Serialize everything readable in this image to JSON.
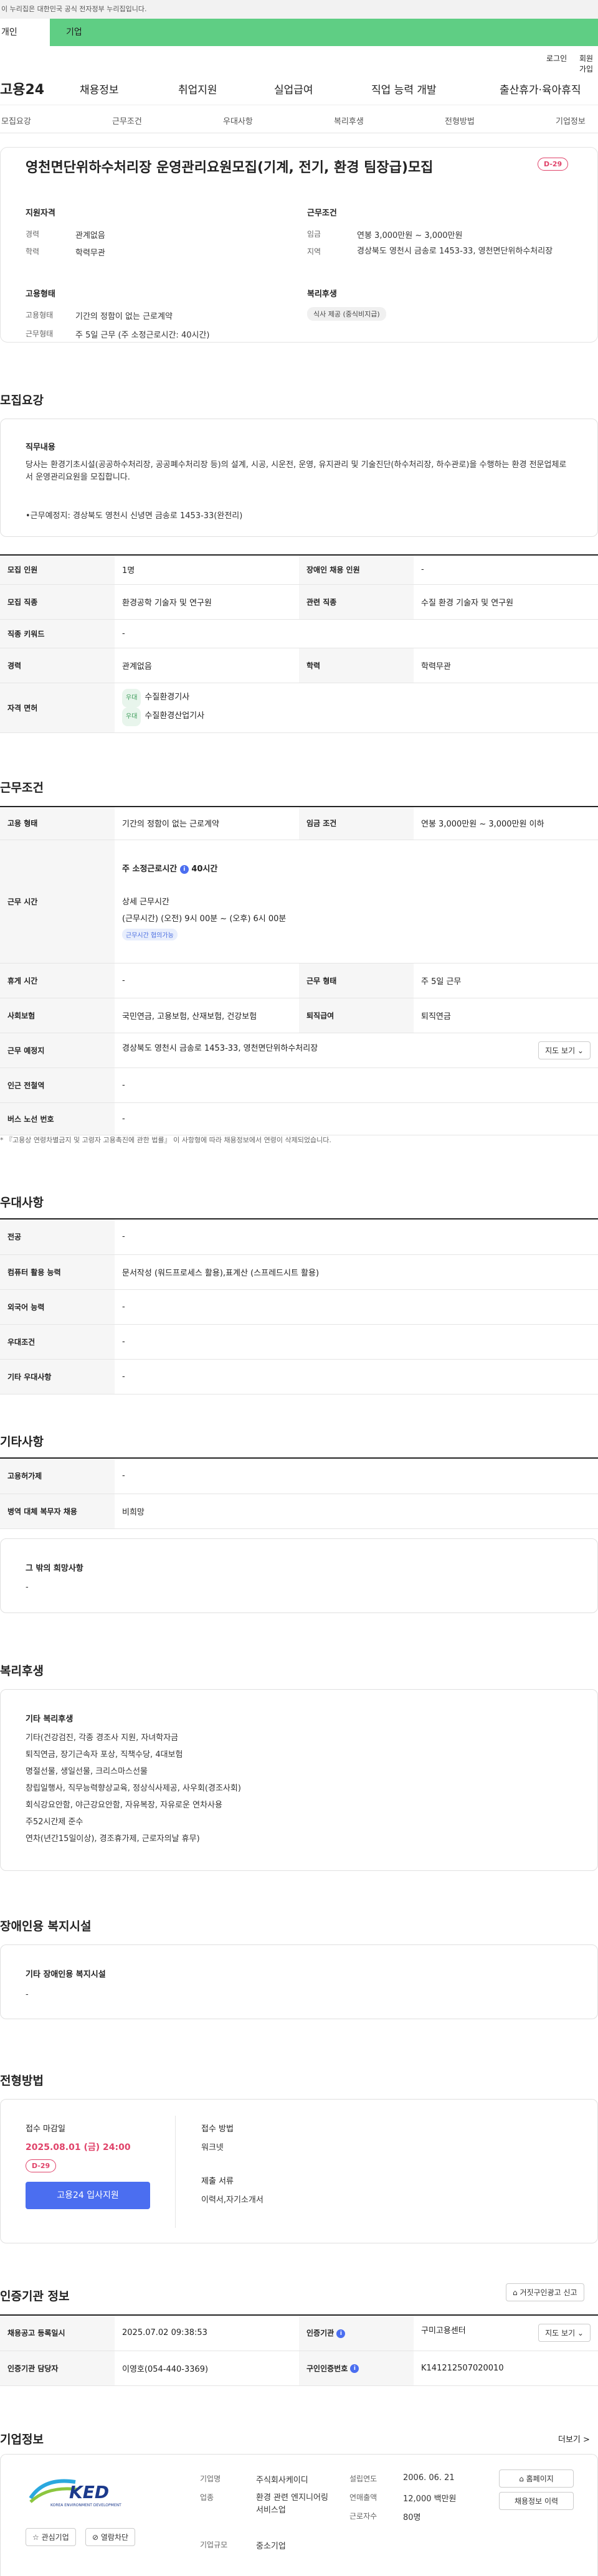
{
  "gov_banner": "이 누리집은 대한민국 공식 전자정부 누리집입니다.",
  "top_tabs": [
    "개인",
    "기업"
  ],
  "util": {
    "login": "로그인",
    "signup": "회원가입"
  },
  "logo": "고용24",
  "gnb": [
    "채용정보",
    "취업지원",
    "실업급여",
    "직업 능력 개발",
    "출산휴가·육아휴직"
  ],
  "snb": [
    "모집요강",
    "근무조건",
    "우대사항",
    "복리후생",
    "전형방법",
    "기업정보"
  ],
  "title_card": {
    "title": "영천면단위하수처리장 운영관리요원모집(기계, 전기, 환경 팀장급)모집",
    "dday": "D-29",
    "qual_title": "지원자격",
    "qual": [
      {
        "k": "경력",
        "v": "관계없음"
      },
      {
        "k": "학력",
        "v": "학력무관"
      }
    ],
    "cond_title": "근무조건",
    "cond": [
      {
        "k": "임금",
        "v": "연봉 3,000만원 ~ 3,000만원"
      },
      {
        "k": "지역",
        "v": "경상북도 영천시 금송로 1453-33, 영천면단위하수처리장"
      }
    ],
    "emp_title": "고용형태",
    "emp": [
      {
        "k": "고용형태",
        "v": "기간의 정함이 없는 근로계약"
      },
      {
        "k": "근무형태",
        "v": "주 5일 근무 (주 소정근로시간: 40시간)"
      }
    ],
    "welfare_title": "복리후생",
    "welfare_chip": "식사 제공 (중식비지급)"
  },
  "recruit": {
    "heading": "모집요강",
    "duty_title": "직무내용",
    "duty_text": "당사는 환경기초시설(공공하수처리장, 공공폐수처리장 등)의 설계, 시공, 시운전, 운영, 유지관리 및 기술진단(하수처리장, 하수관로)을 수행하는 환경 전문업체로서 운영관리요원을 모집합니다.",
    "duty_place": "•근무예정지:  경상북도 영천시 신녕면 금송로 1453-33(완전리)",
    "rows": [
      {
        "k1": "모집 인원",
        "v1": "1명",
        "k2": "장애인 채용 인원",
        "v2": "-"
      },
      {
        "k1": "모집 직종",
        "v1": "환경공학 기술자 및 연구원",
        "k2": "관련 직종",
        "v2": "수질 환경 기술자 및 연구원"
      },
      {
        "k1": "직종 키워드",
        "v1": "-"
      },
      {
        "k1": "경력",
        "v1": "관계없음",
        "k2": "학력",
        "v2": "학력무관"
      }
    ],
    "license_label": "자격 면허",
    "licenses": [
      {
        "tag": "우대",
        "name": "수질환경기사"
      },
      {
        "tag": "우대",
        "name": "수질환경산업기사"
      }
    ]
  },
  "work": {
    "heading": "근무조건",
    "emp_type_k": "고용 형태",
    "emp_type_v": "기간의 정함이 없는 근로계약",
    "wage_k": "임금 조건",
    "wage_v": "연봉 3,000만원 ~ 3,000만원 이하",
    "hours_k": "근무 시간",
    "hours_week": "주 소정근로시간",
    "hours_week_val": "40시간",
    "hours_detail_title": "상세 근무시간",
    "hours_detail": "(근무시간) (오전) 9시 00분 ~ (오후) 6시 00분",
    "hours_tag": "근무시간 협의가능",
    "holiday_k": "휴게 시간",
    "holiday_v": "-",
    "form_k": "근무 형태",
    "form_v": "주 5일 근무",
    "ins_k": "사회보험",
    "ins_v": "국민연금, 고용보험, 산재보험, 건강보험",
    "ret_k": "퇴직급여",
    "ret_v": "퇴직연금",
    "place_k": "근무 예정지",
    "place_v": "경상북도 영천시 금송로 1453-33, 영천면단위하수처리장",
    "map_btn": "지도 보기 ⌄",
    "subway_k": "인근 전철역",
    "subway_v": "-",
    "bus_k": "버스 노선 번호",
    "bus_v": "-",
    "notice": "* 『고용상 연령차별금지 및 고령자 고용촉진에 관한 법률』 이 사항형에 따라 채용정보에서 연령이 삭제되었습니다."
  },
  "pref": {
    "heading": "우대사항",
    "rows": [
      {
        "k": "전공",
        "v": "-"
      },
      {
        "k": "컴퓨터 활용 능력",
        "v": "문서작성 (워드프로세스 활용),표계산 (스프레드시트 활용)"
      },
      {
        "k": "외국어 능력",
        "v": "-"
      },
      {
        "k": "우대조건",
        "v": "-"
      },
      {
        "k": "기타 우대사항",
        "v": "-"
      }
    ]
  },
  "etc": {
    "heading": "기타사항",
    "rows": [
      {
        "k": "고용허가제",
        "v": "-"
      },
      {
        "k": "병역 대체 복무자 채용",
        "v": "비희망"
      }
    ],
    "box_title": "그 밖의 희망사항",
    "box_val": "-"
  },
  "benefit": {
    "heading": "복리후생",
    "box_title": "기타 복리후생",
    "lines": [
      "기타(건강검진, 각종 경조사 지원, 자녀학자금",
      "퇴직연금, 장기근속자 포상, 직책수당, 4대보험",
      "명절선물, 생일선물, 크리스마스선물",
      "창립일행사, 직무능력향상교육, 정상식사제공, 사우회(경조사회)",
      "회식강요안함, 야근강요안함, 자유복장, 자유로운 연차사용",
      "주52시간제 준수",
      "연차(년간15일이상), 경조휴가제, 근로자의날 휴무)"
    ]
  },
  "disabled": {
    "heading": "장애인용 복지시설",
    "box_title": "기타 장애인용 복지시설",
    "box_val": "-"
  },
  "selection": {
    "heading": "전형방법",
    "deadline_label": "접수 마감일",
    "deadline": "2025.08.01 (금) 24:00",
    "dday": "D-29",
    "apply_btn": "고용24 입사지원",
    "method_label": "접수 방법",
    "method": "워크넷",
    "docs_label": "제출 서류",
    "docs": "이력서,자기소개서"
  },
  "agency": {
    "heading": "인증기관 정보",
    "report_btn": "거짓구인광고 신고",
    "reg_k": "채용공고 등록일시",
    "reg_v": "2025.07.02 09:38:53",
    "org_k": "인증기관",
    "org_v": "구미고용센터",
    "map_btn": "지도 보기 ⌄",
    "mgr_k": "인증기관 담당자",
    "mgr_v": "이영호(054-440-3369)",
    "num_k": "구인인증번호",
    "num_v": "K141212507020010"
  },
  "company": {
    "heading": "기업정보",
    "more": "더보기 >",
    "logo_text": "KED",
    "logo_sub": "KOREA ENVIRONMENT DEVELOPMENT",
    "fav_btn": "관심기업",
    "block_btn": "열람차단",
    "info": [
      {
        "k": "기업명",
        "v": "주식회사케이디"
      },
      {
        "k": "업종",
        "v": "환경 관련 엔지니어링 서비스업"
      },
      {
        "k": "기업규모",
        "v": "중소기업"
      }
    ],
    "info2": [
      {
        "k": "설립연도",
        "v": "2006. 06. 21"
      },
      {
        "k": "연매출액",
        "v": "12,000 백만원"
      },
      {
        "k": "근로자수",
        "v": "80명"
      }
    ],
    "home_btn": "홈페이지",
    "jobs_btn": "채용정보 이력"
  },
  "colors": {
    "tab_green": "#5fce84",
    "accent_blue": "#4b6ef0",
    "dday_red": "#e0436a"
  }
}
